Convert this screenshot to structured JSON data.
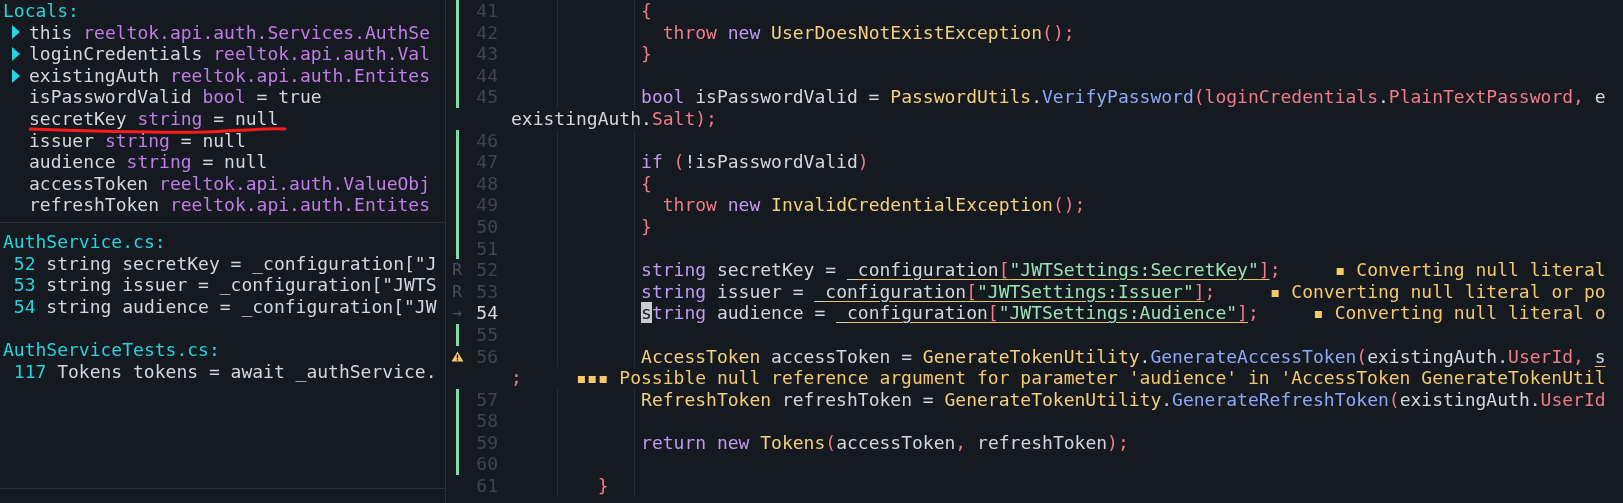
{
  "locals": {
    "title": "Locals:",
    "items": [
      {
        "name": "this",
        "type": "reeltok.api.auth.Services.AuthSe",
        "expandable": true,
        "underlined": false
      },
      {
        "name": "loginCredentials",
        "type": "reeltok.api.auth.Val",
        "expandable": true,
        "underlined": false
      },
      {
        "name": "existingAuth",
        "type": "reeltok.api.auth.Entites",
        "expandable": true,
        "underlined": false
      },
      {
        "name": "isPasswordValid",
        "type": "bool",
        "value": "= true",
        "expandable": false,
        "underlined": false
      },
      {
        "name": "secretKey",
        "type": "string",
        "value": "= null",
        "expandable": false,
        "underlined": true
      },
      {
        "name": "issuer",
        "type": "string",
        "value": "= null",
        "expandable": false,
        "underlined": false
      },
      {
        "name": "audience",
        "type": "string",
        "value": "= null",
        "expandable": false,
        "underlined": false
      },
      {
        "name": "accessToken",
        "type": "reeltok.api.auth.ValueObj",
        "expandable": false,
        "underlined": false
      },
      {
        "name": "refreshToken",
        "type": "reeltok.api.auth.Entites",
        "expandable": false,
        "underlined": false
      }
    ]
  },
  "references": [
    {
      "file": "AuthService.cs:",
      "refs": [
        {
          "line": "52",
          "code": "string secretKey = _configuration[\"J"
        },
        {
          "line": "53",
          "code": "string issuer = _configuration[\"JWTS"
        },
        {
          "line": "54",
          "code": "string audience = _configuration[\"JW"
        }
      ]
    },
    {
      "file": "AuthServiceTests.cs:",
      "refs": [
        {
          "line": "117",
          "code": "Tokens tokens = await _authService."
        }
      ]
    }
  ],
  "editor": {
    "rows": [
      {
        "kind": "line",
        "number": "41",
        "modified": true,
        "warning": false,
        "current": false,
        "tokens": [
          {
            "text": "            {",
            "kind": "punct"
          }
        ]
      },
      {
        "kind": "line",
        "number": "42",
        "modified": true,
        "warning": false,
        "current": false,
        "tokens": [
          {
            "text": "              throw ",
            "kind": "control"
          },
          {
            "text": "new ",
            "kind": "keyword"
          },
          {
            "text": "UserDoesNotExistException",
            "kind": "type"
          },
          {
            "text": "();",
            "kind": "punct"
          }
        ]
      },
      {
        "kind": "line",
        "number": "43",
        "modified": true,
        "warning": false,
        "current": false,
        "tokens": [
          {
            "text": "            }",
            "kind": "punct"
          }
        ]
      },
      {
        "kind": "line",
        "number": "44",
        "modified": true,
        "warning": false,
        "current": false,
        "tokens": []
      },
      {
        "kind": "line",
        "number": "45",
        "modified": true,
        "warning": false,
        "current": false,
        "tokens": [
          {
            "text": "            bool",
            "kind": "keyword"
          },
          {
            "text": " isPasswordValid = ",
            "kind": "plain"
          },
          {
            "text": "PasswordUtils",
            "kind": "type"
          },
          {
            "text": ".",
            "kind": "plain"
          },
          {
            "text": "VerifyPassword",
            "kind": "method"
          },
          {
            "text": "(",
            "kind": "punct"
          },
          {
            "text": "loginCredentials",
            "kind": "member"
          },
          {
            "text": ".",
            "kind": "plain"
          },
          {
            "text": "PlainTextPassword",
            "kind": "member"
          },
          {
            "text": ", ",
            "kind": "punct"
          },
          {
            "text": "e",
            "kind": "plain"
          }
        ]
      },
      {
        "kind": "wrap",
        "tokens": [
          {
            "text": "existingAuth.",
            "kind": "plain"
          },
          {
            "text": "Salt",
            "kind": "member"
          },
          {
            "text": ");",
            "kind": "punct"
          }
        ]
      },
      {
        "kind": "line",
        "number": "46",
        "modified": true,
        "warning": false,
        "current": false,
        "tokens": []
      },
      {
        "kind": "line",
        "number": "47",
        "modified": true,
        "warning": false,
        "current": false,
        "tokens": [
          {
            "text": "            if ",
            "kind": "keyword"
          },
          {
            "text": "(",
            "kind": "punct"
          },
          {
            "text": "!isPasswordValid",
            "kind": "plain"
          },
          {
            "text": ")",
            "kind": "punct"
          }
        ]
      },
      {
        "kind": "line",
        "number": "48",
        "modified": true,
        "warning": false,
        "current": false,
        "tokens": [
          {
            "text": "            {",
            "kind": "punct"
          }
        ]
      },
      {
        "kind": "line",
        "number": "49",
        "modified": true,
        "warning": false,
        "current": false,
        "tokens": [
          {
            "text": "              throw ",
            "kind": "control"
          },
          {
            "text": "new ",
            "kind": "keyword"
          },
          {
            "text": "InvalidCredentialException",
            "kind": "type"
          },
          {
            "text": "();",
            "kind": "punct"
          }
        ]
      },
      {
        "kind": "line",
        "number": "50",
        "modified": true,
        "warning": false,
        "current": false,
        "tokens": [
          {
            "text": "            }",
            "kind": "punct"
          }
        ]
      },
      {
        "kind": "line",
        "number": "51",
        "modified": true,
        "warning": false,
        "current": false,
        "tokens": []
      },
      {
        "kind": "line",
        "number": "52",
        "sign": "R",
        "modified": false,
        "warning": false,
        "current": false,
        "tokens": [
          {
            "text": "            string",
            "kind": "keyword"
          },
          {
            "text": " secretKey = ",
            "kind": "plain"
          },
          {
            "text": "_configuration",
            "kind": "plain",
            "warn": true
          },
          {
            "text": "[",
            "kind": "punct",
            "warn": true
          },
          {
            "text": "\"JWTSettings:SecretKey\"",
            "kind": "string",
            "warn": true
          },
          {
            "text": "]",
            "kind": "punct",
            "warn": true
          },
          {
            "text": ";",
            "kind": "punct"
          }
        ],
        "diagnostic": "▪ Converting null literal"
      },
      {
        "kind": "line",
        "number": "53",
        "sign": "R",
        "modified": false,
        "warning": false,
        "current": false,
        "tokens": [
          {
            "text": "            string",
            "kind": "keyword"
          },
          {
            "text": " issuer = ",
            "kind": "plain"
          },
          {
            "text": "_configuration",
            "kind": "plain",
            "warn": true
          },
          {
            "text": "[",
            "kind": "punct",
            "warn": true
          },
          {
            "text": "\"JWTSettings:Issuer\"",
            "kind": "string",
            "warn": true
          },
          {
            "text": "]",
            "kind": "punct",
            "warn": true
          },
          {
            "text": ";",
            "kind": "punct"
          }
        ],
        "diagnostic": "▪ Converting null literal or po"
      },
      {
        "kind": "line",
        "number": "54",
        "sign": "→",
        "modified": false,
        "warning": false,
        "current": true,
        "tokens": [
          {
            "text": "            s",
            "kind": "cursor"
          },
          {
            "text": "tring",
            "kind": "keyword"
          },
          {
            "text": " audience = ",
            "kind": "plain"
          },
          {
            "text": "_configuration",
            "kind": "plain",
            "warn": true
          },
          {
            "text": "[",
            "kind": "punct",
            "warn": true
          },
          {
            "text": "\"JWTSettings:Audience\"",
            "kind": "string",
            "warn": true
          },
          {
            "text": "]",
            "kind": "punct",
            "warn": true
          },
          {
            "text": ";",
            "kind": "punct"
          }
        ],
        "diagnostic": "▪ Converting null literal o"
      },
      {
        "kind": "line",
        "number": "55",
        "modified": true,
        "warning": false,
        "current": false,
        "tokens": []
      },
      {
        "kind": "line",
        "number": "56",
        "modified": false,
        "warning": true,
        "current": false,
        "tokens": [
          {
            "text": "            AccessToken",
            "kind": "type"
          },
          {
            "text": " accessToken = ",
            "kind": "plain"
          },
          {
            "text": "GenerateTokenUtility",
            "kind": "type"
          },
          {
            "text": ".",
            "kind": "plain"
          },
          {
            "text": "GenerateAccessToken",
            "kind": "method"
          },
          {
            "text": "(",
            "kind": "punct"
          },
          {
            "text": "existingAuth",
            "kind": "plain"
          },
          {
            "text": ".",
            "kind": "plain"
          },
          {
            "text": "UserId",
            "kind": "member"
          },
          {
            "text": ", ",
            "kind": "punct"
          },
          {
            "text": "s",
            "kind": "plain",
            "warn": true
          }
        ]
      },
      {
        "kind": "wrap",
        "tokens": [
          {
            "text": ";",
            "kind": "punct"
          }
        ],
        "diagnostic": "▪▪▪ Possible null reference argument for parameter 'audience' in 'AccessToken GenerateTokenUtil"
      },
      {
        "kind": "line",
        "number": "57",
        "modified": true,
        "warning": false,
        "current": false,
        "tokens": [
          {
            "text": "            RefreshToken",
            "kind": "type"
          },
          {
            "text": " refreshToken = ",
            "kind": "plain"
          },
          {
            "text": "GenerateTokenUtility",
            "kind": "type"
          },
          {
            "text": ".",
            "kind": "plain"
          },
          {
            "text": "GenerateRefreshToken",
            "kind": "method"
          },
          {
            "text": "(",
            "kind": "punct"
          },
          {
            "text": "existingAuth",
            "kind": "plain"
          },
          {
            "text": ".",
            "kind": "plain"
          },
          {
            "text": "UserId",
            "kind": "member"
          }
        ]
      },
      {
        "kind": "line",
        "number": "58",
        "modified": true,
        "warning": false,
        "current": false,
        "tokens": []
      },
      {
        "kind": "line",
        "number": "59",
        "modified": true,
        "warning": false,
        "current": false,
        "tokens": [
          {
            "text": "            return ",
            "kind": "keyword"
          },
          {
            "text": "new ",
            "kind": "keyword"
          },
          {
            "text": "Tokens",
            "kind": "type"
          },
          {
            "text": "(",
            "kind": "punct"
          },
          {
            "text": "accessToken",
            "kind": "plain"
          },
          {
            "text": ", ",
            "kind": "punct"
          },
          {
            "text": "refreshToken",
            "kind": "plain"
          },
          {
            "text": ");",
            "kind": "punct"
          }
        ]
      },
      {
        "kind": "line",
        "number": "60",
        "modified": true,
        "warning": false,
        "current": false,
        "tokens": []
      },
      {
        "kind": "line",
        "number": "61",
        "modified": false,
        "warning": false,
        "current": false,
        "tokens": [
          {
            "text": "        }",
            "kind": "punct"
          }
        ]
      }
    ]
  }
}
